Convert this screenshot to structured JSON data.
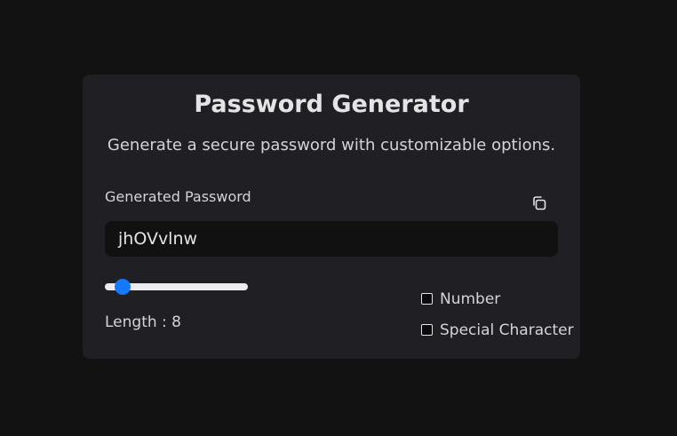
{
  "card": {
    "title": "Password Generator",
    "subtitle": "Generate a secure password with customizable options."
  },
  "password": {
    "label": "Generated Password",
    "value": "jhOVvlnw",
    "copy_icon": "copy-icon"
  },
  "length": {
    "label": "Length : 8",
    "value": 8,
    "min": 6,
    "max": 50
  },
  "options": {
    "number_label": "Number",
    "number_checked": false,
    "special_label": "Special Character",
    "special_checked": false
  },
  "colors": {
    "background": "#121212",
    "card": "#202024",
    "input": "#111111",
    "accent": "#1677ff"
  }
}
